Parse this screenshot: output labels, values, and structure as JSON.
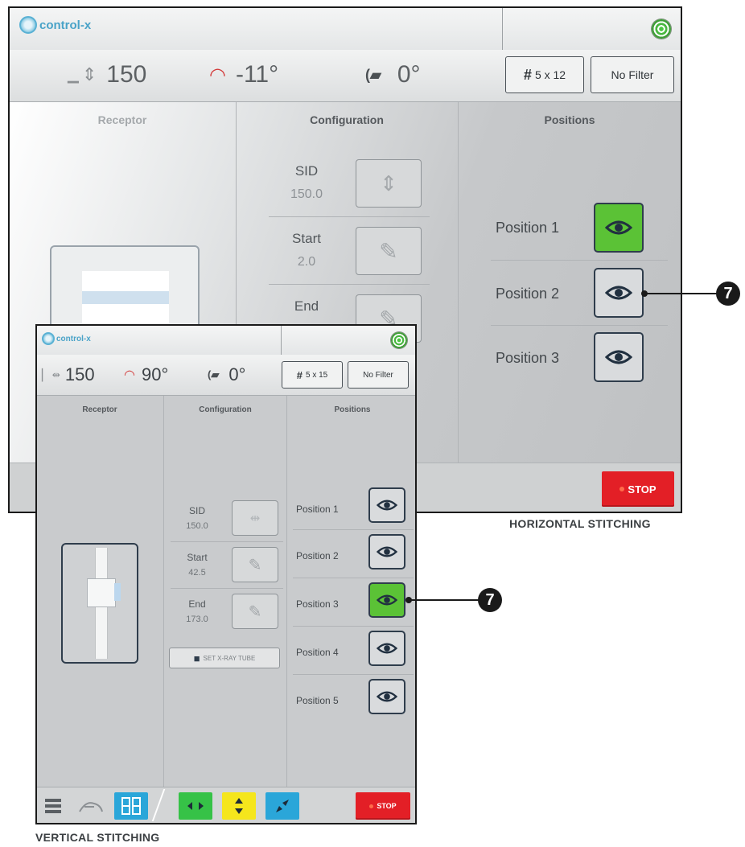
{
  "horizontal": {
    "app_name": "control-x",
    "status": {
      "sid_value": "150",
      "angle_value": "-11°",
      "tilt_value": "0°",
      "grid_label": "5 x 12",
      "filter_label": "No Filter"
    },
    "columns": {
      "receptor": "Receptor",
      "configuration": "Configuration",
      "positions": "Positions"
    },
    "config": [
      {
        "label": "SID",
        "value": "150.0",
        "icon": "sid-stitch-icon"
      },
      {
        "label": "Start",
        "value": "2.0",
        "icon": "pencil-icon"
      },
      {
        "label": "End",
        "value": "",
        "icon": "pencil-icon"
      }
    ],
    "positions": [
      {
        "label": "Position 1",
        "active": true
      },
      {
        "label": "Position 2",
        "active": false
      },
      {
        "label": "Position 3",
        "active": false
      }
    ],
    "stop_label": "STOP",
    "caption": "HORIZONTAL STITCHING",
    "callout": "7"
  },
  "vertical": {
    "app_name": "control-x",
    "status": {
      "sid_value": "150",
      "angle_value": "90°",
      "tilt_value": "0°",
      "grid_label": "5 x 15",
      "filter_label": "No Filter"
    },
    "columns": {
      "receptor": "Receptor",
      "configuration": "Configuration",
      "positions": "Positions"
    },
    "config": [
      {
        "label": "SID",
        "value": "150.0",
        "icon": "sid-horizontal-icon"
      },
      {
        "label": "Start",
        "value": "42.5",
        "icon": "pencil-icon"
      },
      {
        "label": "End",
        "value": "173.0",
        "icon": "pencil-icon"
      }
    ],
    "set_xray_tube_label": "SET X-RAY TUBE",
    "positions": [
      {
        "label": "Position 1",
        "active": false
      },
      {
        "label": "Position 2",
        "active": false
      },
      {
        "label": "Position 3",
        "active": true
      },
      {
        "label": "Position 4",
        "active": false
      },
      {
        "label": "Position 5",
        "active": false
      }
    ],
    "stop_label": "STOP",
    "caption": "VERTICAL STITCHING",
    "callout": "7"
  },
  "colors": {
    "active_green": "#5bc236",
    "stop_red": "#e31f26",
    "brand_blue": "#4aa3c8",
    "toolbar_green": "#36c247",
    "toolbar_yellow": "#f5e61c",
    "toolbar_blue": "#2aa6d9"
  }
}
